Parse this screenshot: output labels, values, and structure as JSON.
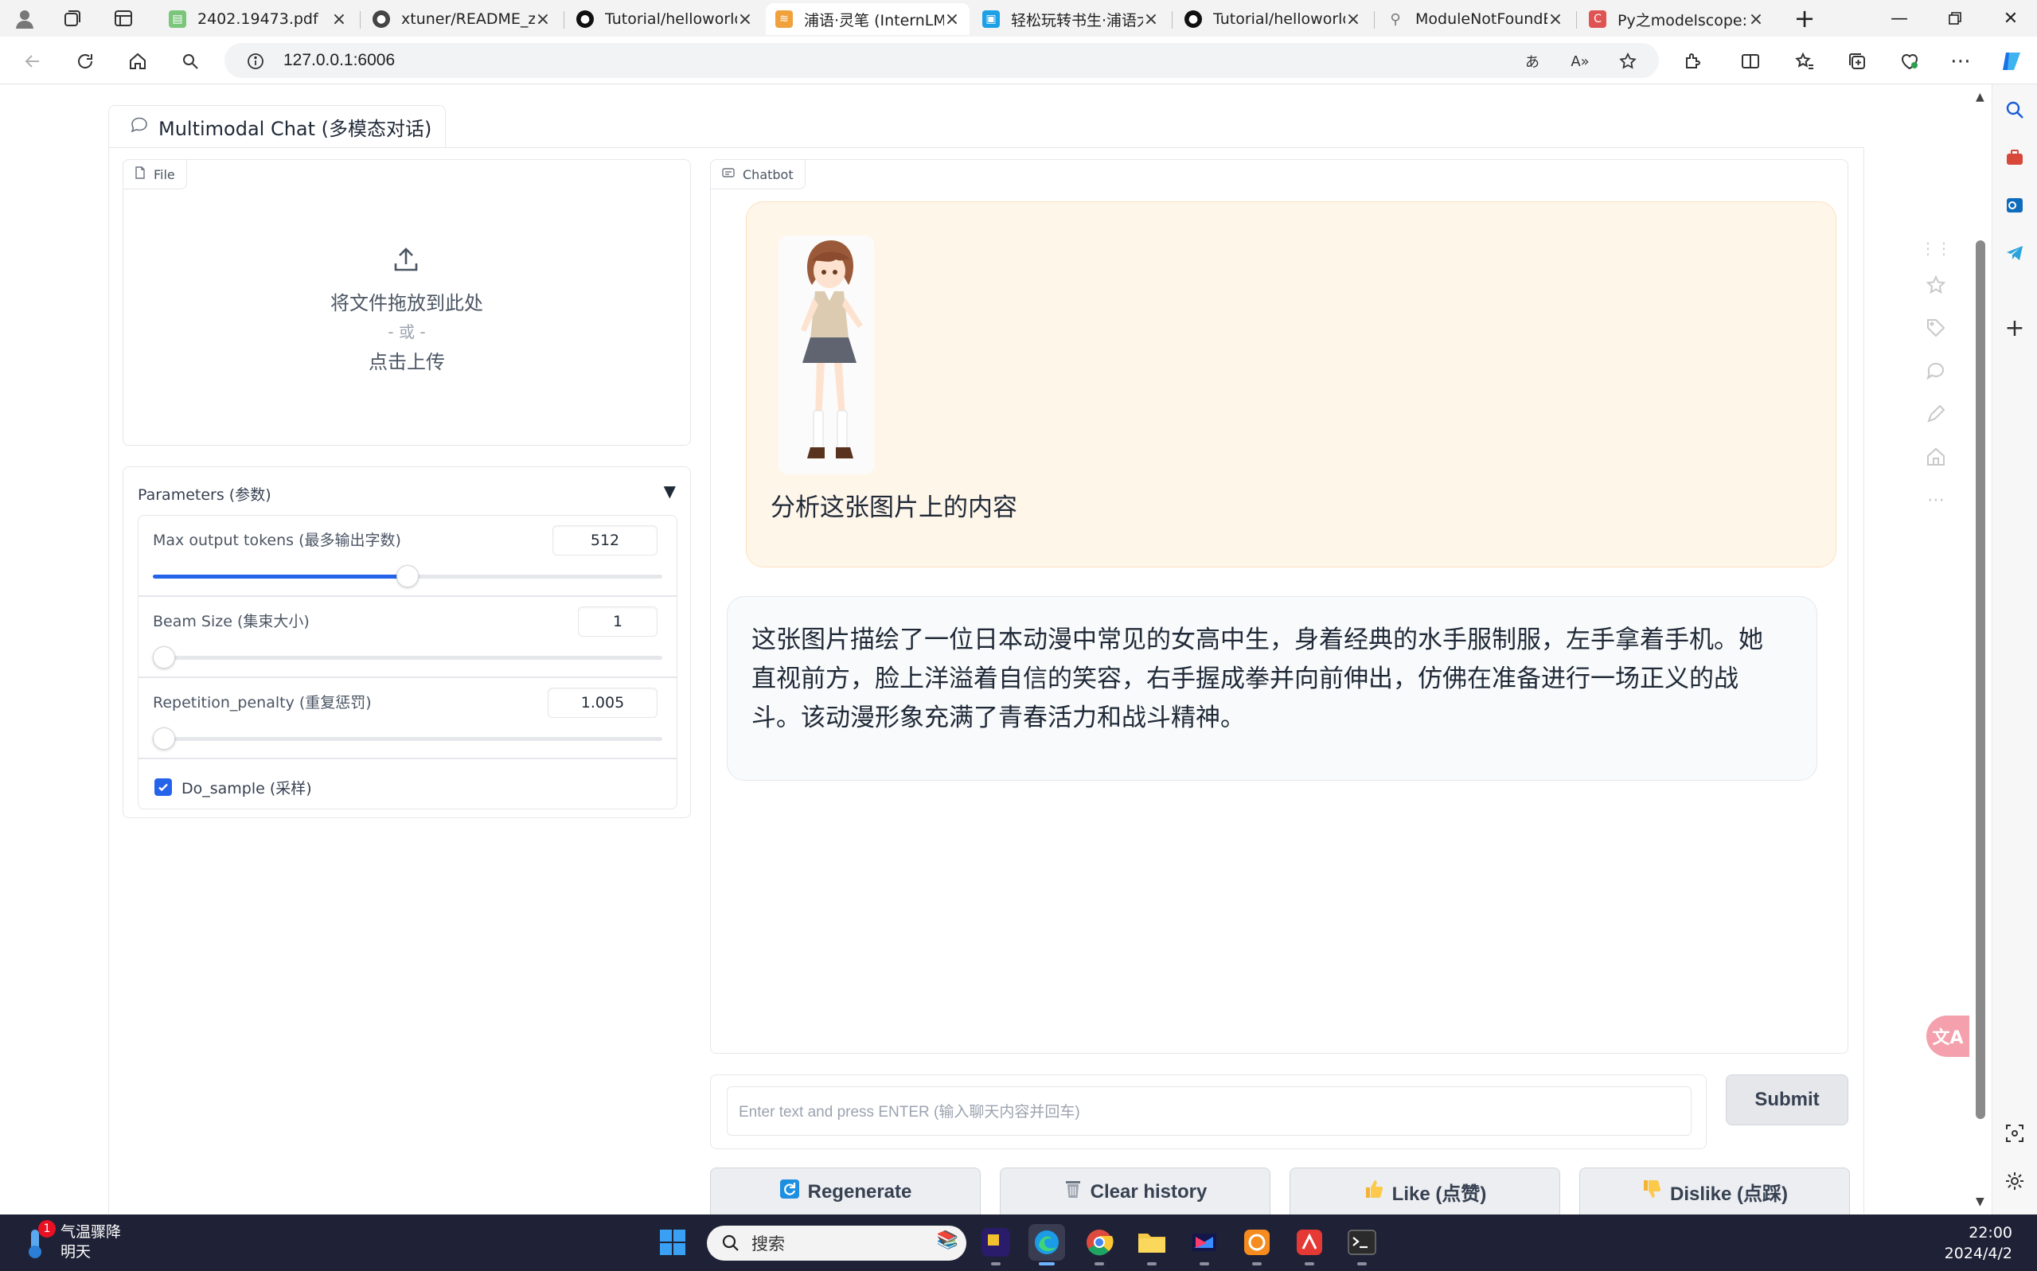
{
  "browser": {
    "tabs": [
      {
        "title": "2402.19473.pdf",
        "favicon": "pdf-icon",
        "color": "#7bc67b",
        "active": false
      },
      {
        "title": "xtuner/README_zh",
        "favicon": "github-icon",
        "color": "#444444",
        "active": false
      },
      {
        "title": "Tutorial/helloworld/",
        "favicon": "github-icon",
        "color": "#111111",
        "active": false
      },
      {
        "title": "浦语·灵笔 (InternLM",
        "favicon": "internlm-icon",
        "color": "#f0a13c",
        "active": true
      },
      {
        "title": "轻松玩转书生·浦语大",
        "favicon": "bilibili-icon",
        "color": "#1ea0e6",
        "active": false
      },
      {
        "title": "Tutorial/helloworld/",
        "favicon": "github-icon",
        "color": "#111111",
        "active": false
      },
      {
        "title": "ModuleNotFoundEr",
        "favicon": "search-icon",
        "color": "#777777",
        "active": false
      },
      {
        "title": "Py之modelscope: ",
        "favicon": "csdn-icon",
        "color": "#e05353",
        "active": false
      }
    ],
    "url": "127.0.0.1:6006"
  },
  "app": {
    "tab_label": "Multimodal Chat (多模态对话)",
    "file_label": "File",
    "upload": {
      "line1": "将文件拖放到此处",
      "line2": "- 或 -",
      "line3": "点击上传"
    },
    "params": {
      "title": "Parameters (参数)",
      "max_tokens": {
        "label": "Max output tokens (最多输出字数)",
        "value": "512",
        "fraction": 0.5
      },
      "beam": {
        "label": "Beam Size (集束大小)",
        "value": "1",
        "fraction": 0.0
      },
      "rep_penalty": {
        "label": "Repetition_penalty (重复惩罚)",
        "value": "1.005",
        "fraction": 0.005
      },
      "do_sample": {
        "label": "Do_sample (采样)",
        "checked": true
      }
    },
    "chatbot_label": "Chatbot",
    "messages": {
      "user_text": "分析这张图片上的内容",
      "bot_text": "这张图片描绘了一位日本动漫中常见的女高中生，身着经典的水手服制服，左手拿着手机。她直视前方，脸上洋溢着自信的笑容，右手握成拳并向前伸出，仿佛在准备进行一场正义的战斗。该动漫形象充满了青春活力和战斗精神。"
    },
    "input_placeholder": "Enter text and press ENTER (输入聊天内容并回车)",
    "submit_label": "Submit",
    "actions": {
      "regenerate": "Regenerate",
      "clear": "Clear history",
      "like": "Like (点赞)",
      "dislike": "Dislike (点踩)"
    }
  },
  "taskbar": {
    "weather_title": "气温骤降",
    "weather_sub": "明天",
    "weather_badge": "1",
    "search_placeholder": "搜索",
    "time": "22:00",
    "date": "2024/4/2"
  }
}
